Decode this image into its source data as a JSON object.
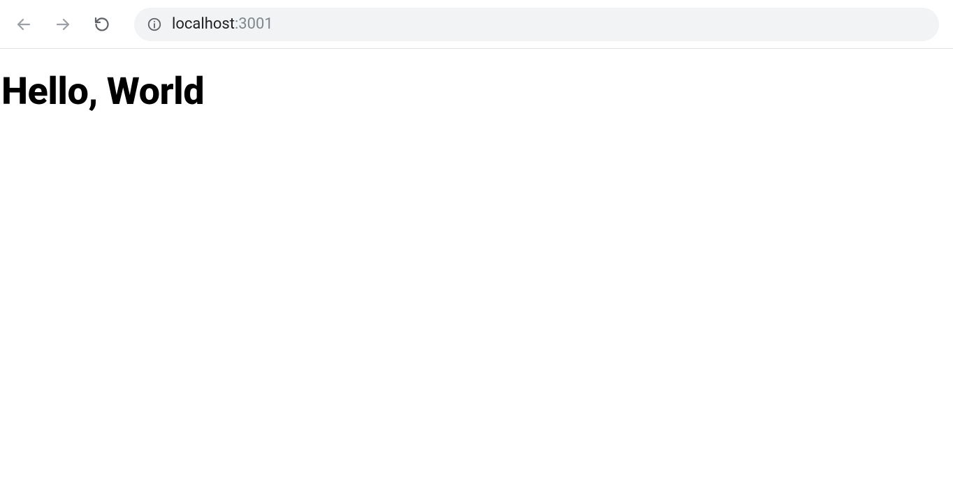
{
  "browser": {
    "url_host": "localhost",
    "url_port": ":3001"
  },
  "page": {
    "heading": "Hello, World"
  }
}
